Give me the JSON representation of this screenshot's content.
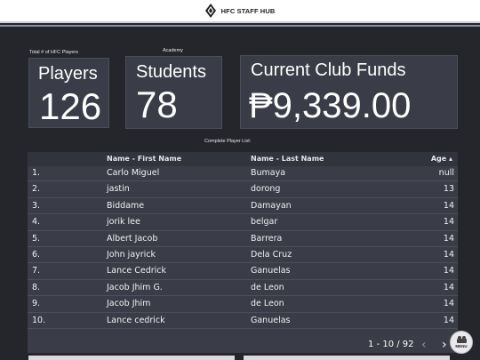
{
  "app": {
    "title": "HFC STAFF HUB"
  },
  "stats": {
    "players_caption": "Total # of HFC Players",
    "players_label": "Players",
    "players_value": "126",
    "academy_caption": "Academy",
    "students_label": "Students",
    "students_value": "78",
    "funds_label": "Current Club Funds",
    "funds_value": "₱9,339.00"
  },
  "table": {
    "caption": "Complete Player List:",
    "headers": {
      "first": "Name - First Name",
      "last": "Name - Last Name",
      "age": "Age ▴"
    },
    "rows": [
      {
        "idx": "1.",
        "first": "Carlo Miguel",
        "last": "Bumaya",
        "age": "null"
      },
      {
        "idx": "2.",
        "first": "jastin",
        "last": "dorong",
        "age": "13"
      },
      {
        "idx": "3.",
        "first": "Biddame",
        "last": "Damayan",
        "age": "14"
      },
      {
        "idx": "4.",
        "first": "jorik lee",
        "last": "belgar",
        "age": "14"
      },
      {
        "idx": "5.",
        "first": "Albert Jacob",
        "last": "Barrera",
        "age": "14"
      },
      {
        "idx": "6.",
        "first": "John jayrick",
        "last": "Dela Cruz",
        "age": "14"
      },
      {
        "idx": "7.",
        "first": "Lance Cedrick",
        "last": "Ganuelas",
        "age": "14"
      },
      {
        "idx": "8.",
        "first": "Jacob Jhim G.",
        "last": "de Leon",
        "age": "14"
      },
      {
        "idx": "9.",
        "first": "Jacob Jhim",
        "last": "de Leon",
        "age": "14"
      },
      {
        "idx": "10.",
        "first": "Lance cedrick",
        "last": "Ganuelas",
        "age": "14"
      }
    ],
    "pagination": "1 - 10 / 92"
  },
  "menu": {
    "label": "MENU",
    "icon": "menu-icon"
  },
  "icons": {
    "prev": "chevron-left-icon",
    "next": "chevron-right-icon",
    "logo": "hfc-logo-icon"
  },
  "colors": {
    "background": "#24262c",
    "card": "#3a3d47",
    "topbar": "#ffffff"
  }
}
